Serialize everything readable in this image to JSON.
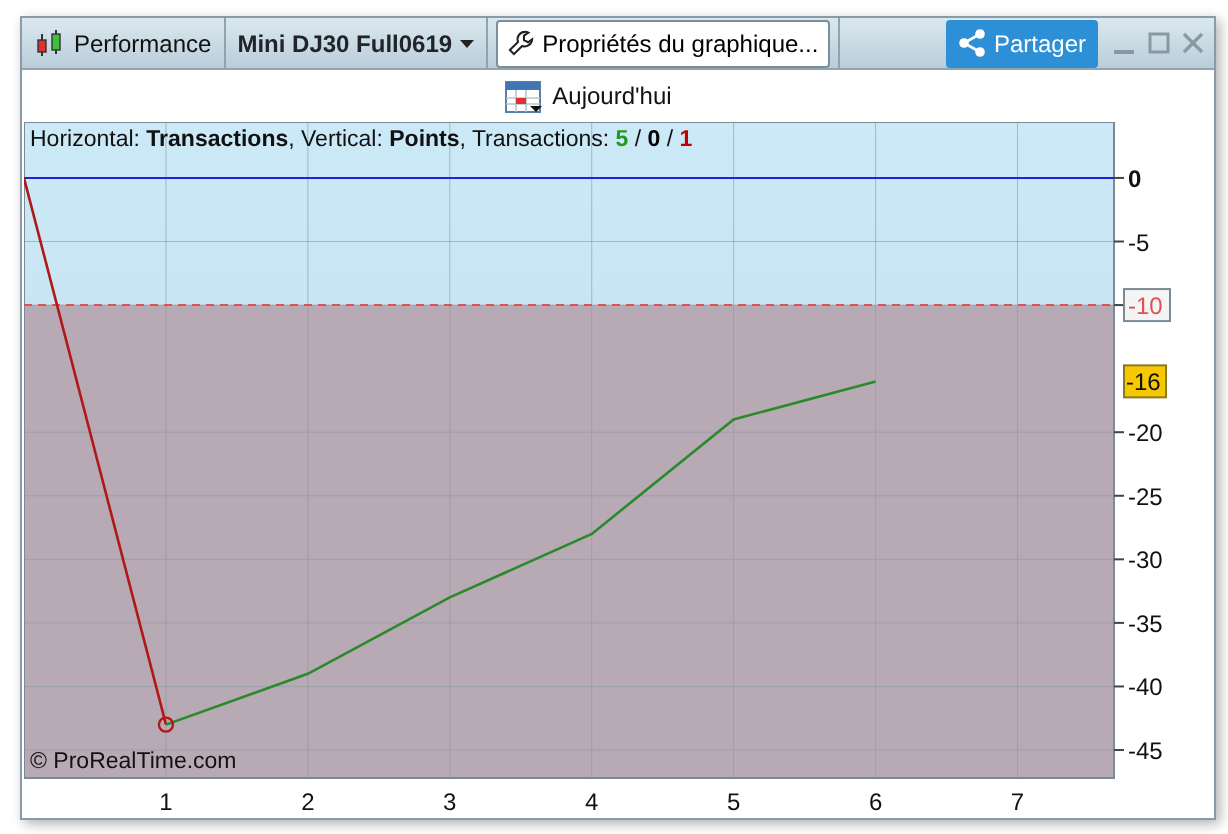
{
  "window": {
    "title": "Performance",
    "instrument": "Mini DJ30 Full0619",
    "properties_button": "Propriétés du graphique...",
    "share_button": "Partager"
  },
  "toolbar": {
    "date_button": "Aujourd'hui"
  },
  "info": {
    "text": "Horizontal: **Transactions**, Vertical: **Points**, Transactions:",
    "separator": "/",
    "counts": [
      {
        "text": "5",
        "color": "#1e9a1e"
      },
      {
        "text": "0",
        "color": "#000000"
      },
      {
        "text": "1",
        "color": "#c00000"
      }
    ]
  },
  "copyright": "© ProRealTime.com",
  "chart_data": {
    "type": "line",
    "x": [
      0,
      1,
      2,
      3,
      4,
      5,
      6
    ],
    "series": [
      {
        "color": "#b01818",
        "values": [
          0,
          -43,
          null,
          null,
          null,
          null,
          null
        ]
      },
      {
        "color": "#2a8a2a",
        "values": [
          null,
          -43,
          -39,
          -33,
          -28,
          -19,
          -16
        ]
      }
    ],
    "xlim": [
      0,
      7.68
    ],
    "ylim": [
      -47.2,
      4.4
    ],
    "xticks": [
      1,
      2,
      3,
      4,
      5,
      6,
      7
    ],
    "yticks": [
      0,
      -5,
      -10,
      -20,
      -25,
      -30,
      -35,
      -40,
      -45
    ],
    "grid": true,
    "ref_lines": [
      {
        "axis": "y",
        "value": 0,
        "color": "#2020e0"
      },
      {
        "axis": "y",
        "value": -10,
        "color": "#e05050",
        "label": "-10"
      }
    ],
    "bands": [
      {
        "axis": "y",
        "from": -47.2,
        "to": -10,
        "color": "#b8aab4"
      }
    ],
    "annotations": [
      "-16"
    ]
  }
}
